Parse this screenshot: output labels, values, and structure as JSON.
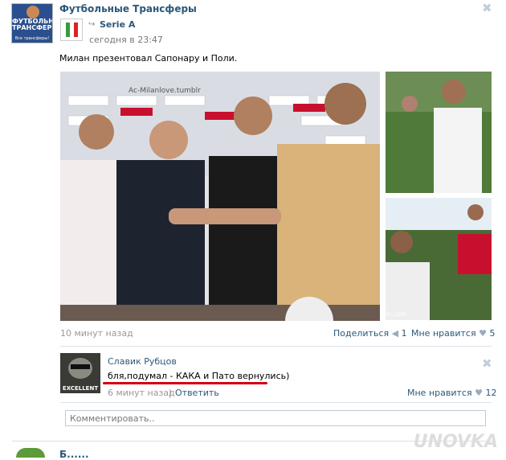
{
  "post": {
    "group_name": "Футбольные Трансферы",
    "group_avatar_text": "ФУТБОЛЬНЫЕ ТРАНСФЕРЫ",
    "group_avatar_sub": "Все трансферы!",
    "close_glyph": "✖",
    "repost_icon": "repost-arrow-icon",
    "repost_source": "Serie A",
    "time": "сегодня в 23:47",
    "text": "Милан презентовал Сапонару и Поли.",
    "photo_main_caption": "Ac-Milanlove.tumblr",
    "photo_side_caption": "ln.com",
    "footer_time": "10 минут назад",
    "share_label": "Поделиться",
    "share_count": "1",
    "like_label": "Мне нравится",
    "like_count": "5"
  },
  "comment": {
    "author": "Славик Рубцов",
    "text": "бля,подумал - КАКА и Пато вернулись)",
    "avatar_badge": "EXCELLENT",
    "time": "6 минут назад",
    "separator": "|",
    "reply_label": "Ответить",
    "like_label": "Мне нравится",
    "like_count": "12",
    "underline_color": "#d4000c"
  },
  "comment_input": {
    "placeholder": "Комментировать.."
  },
  "next_post": {
    "name_partial": "Б......"
  },
  "watermark": "UNOVKA",
  "colors": {
    "link": "#2b587a",
    "heart": "#9aabc0"
  }
}
